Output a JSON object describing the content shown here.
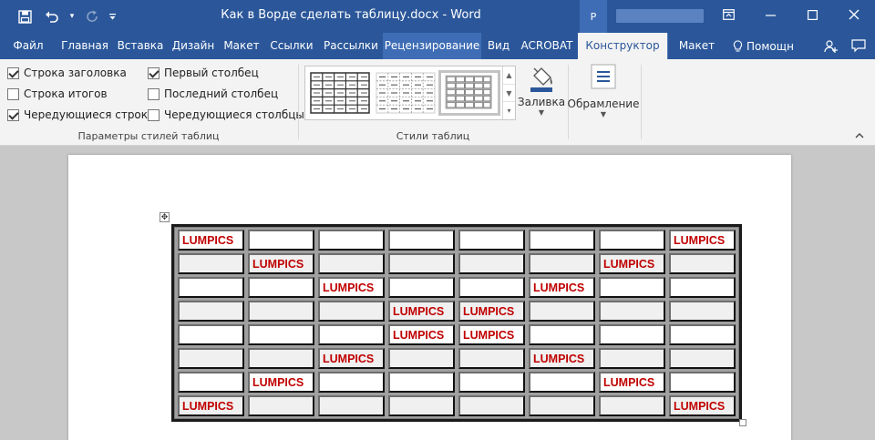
{
  "window": {
    "title": "Как в Ворде сделать таблицу.docx - Word",
    "account_initial": "Р"
  },
  "tabs": [
    {
      "label": "Файл"
    },
    {
      "label": "Главная"
    },
    {
      "label": "Вставка"
    },
    {
      "label": "Дизайн"
    },
    {
      "label": "Макет"
    },
    {
      "label": "Ссылки"
    },
    {
      "label": "Рассылки"
    },
    {
      "label": "Рецензирование"
    },
    {
      "label": "Вид"
    },
    {
      "label": "ACROBAT"
    },
    {
      "label": "Конструктор"
    },
    {
      "label": "Макет"
    }
  ],
  "help": {
    "label": "Помощн"
  },
  "ribbon": {
    "options": {
      "header_row": "Строка заголовка",
      "total_row": "Строка итогов",
      "banded_rows": "Чередующиеся строки",
      "first_column": "Первый столбец",
      "last_column": "Последний столбец",
      "banded_columns": "Чередующиеся столбцы",
      "group_label": "Параметры стилей таблиц"
    },
    "styles": {
      "group_label": "Стили таблиц"
    },
    "shading": {
      "label": "Заливка"
    },
    "borders": {
      "label": "Обрамление"
    }
  },
  "colors": {
    "word_blue": "#2b579a",
    "cell_text": "#c00000"
  },
  "table": {
    "rows": [
      [
        "LUMPICS",
        "",
        "",
        "",
        "",
        "",
        "",
        "LUMPICS"
      ],
      [
        "",
        "LUMPICS",
        "",
        "",
        "",
        "",
        "LUMPICS",
        ""
      ],
      [
        "",
        "",
        "LUMPICS",
        "",
        "",
        "LUMPICS",
        "",
        ""
      ],
      [
        "",
        "",
        "",
        "LUMPICS",
        "LUMPICS",
        "",
        "",
        ""
      ],
      [
        "",
        "",
        "",
        "LUMPICS",
        "LUMPICS",
        "",
        "",
        ""
      ],
      [
        "",
        "",
        "LUMPICS",
        "",
        "",
        "LUMPICS",
        "",
        ""
      ],
      [
        "",
        "LUMPICS",
        "",
        "",
        "",
        "",
        "LUMPICS",
        ""
      ],
      [
        "LUMPICS",
        "",
        "",
        "",
        "",
        "",
        "",
        "LUMPICS"
      ]
    ]
  }
}
